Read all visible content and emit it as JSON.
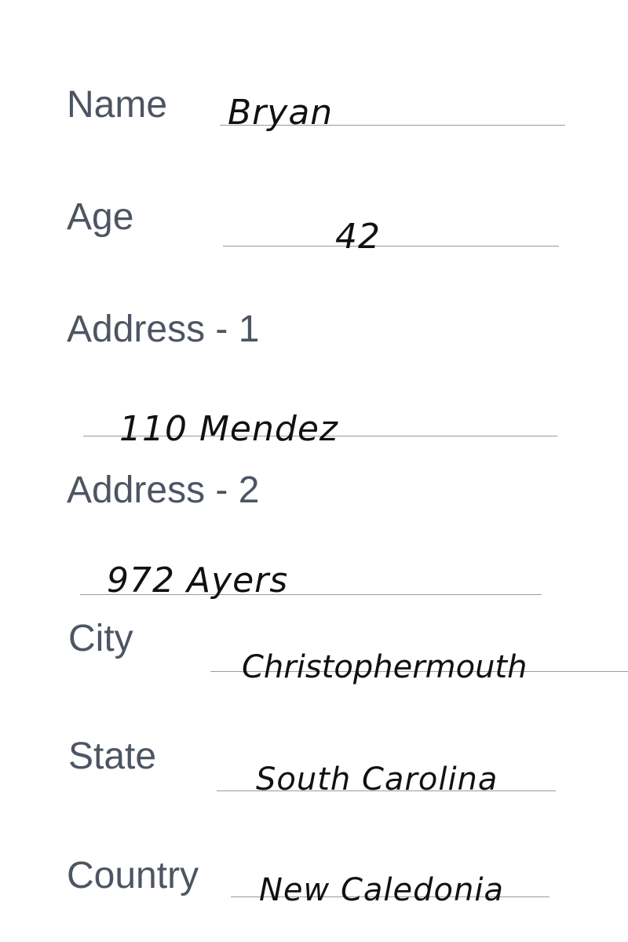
{
  "fields": {
    "name": {
      "label": "Name",
      "value": "Bryan"
    },
    "age": {
      "label": "Age",
      "value": "42"
    },
    "address1": {
      "label": "Address - 1",
      "value": "110 Mendez"
    },
    "address2": {
      "label": "Address - 2",
      "value": "972 Ayers"
    },
    "city": {
      "label": "City",
      "value": "Christophermouth"
    },
    "state": {
      "label": "State",
      "value": "South Carolina"
    },
    "country": {
      "label": "Country",
      "value": "New Caledonia"
    }
  }
}
